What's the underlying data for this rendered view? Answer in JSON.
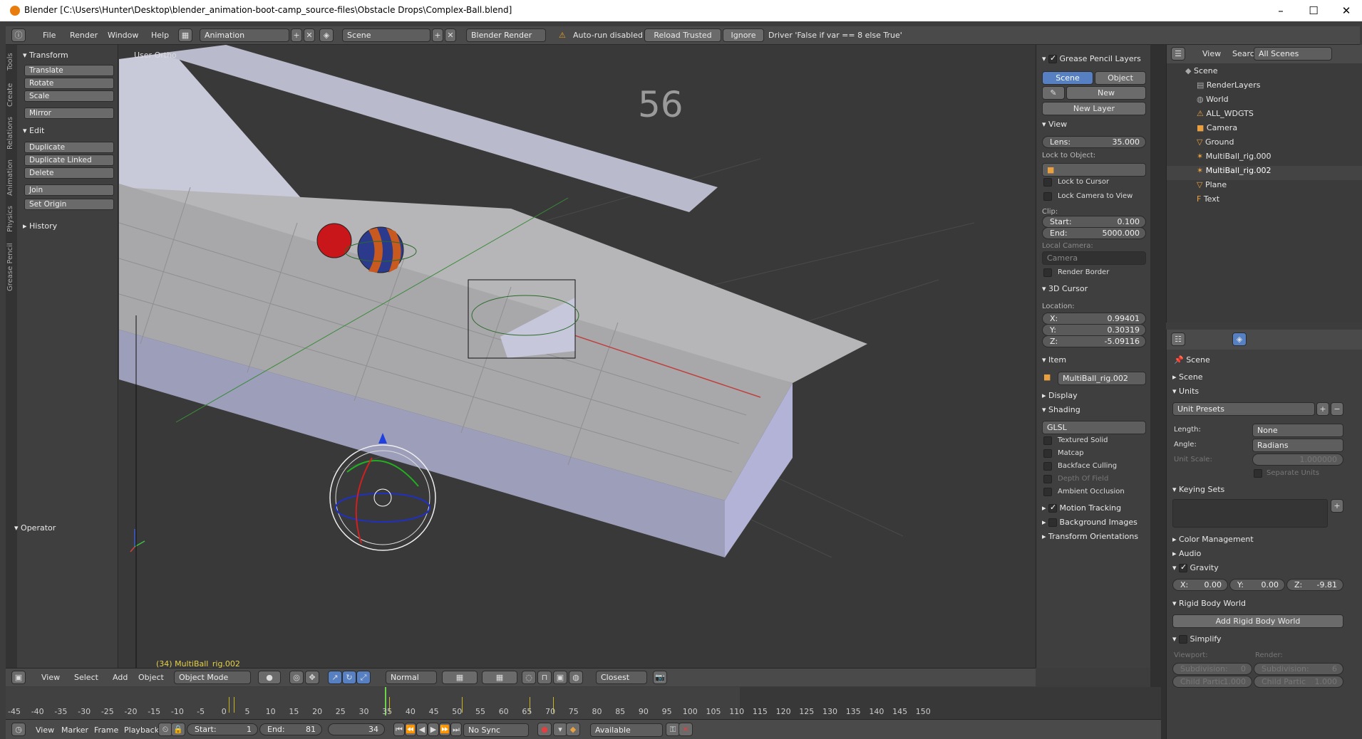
{
  "window": {
    "title": "Blender [C:\\Users\\Hunter\\Desktop\\blender_animation-boot-camp_source-files\\Obstacle Drops\\Complex-Ball.blend]",
    "minimize": "–",
    "maximize": "☐",
    "close": "✕"
  },
  "infobar": {
    "menus": [
      "File",
      "Render",
      "Window",
      "Help"
    ],
    "screen_layout": "Animation",
    "scene": "Scene",
    "engine": "Blender Render",
    "warning": "Auto-run disabled",
    "reload_trusted": "Reload Trusted",
    "ignore": "Ignore",
    "driver_msg": "Driver 'False if var == 8 else True'"
  },
  "toolshelf": {
    "tabs": [
      "Tools",
      "Create",
      "Relations",
      "Animation",
      "Physics",
      "Grease Pencil"
    ],
    "transform_header": "Transform",
    "transform_buttons": [
      "Translate",
      "Rotate",
      "Scale",
      "Mirror"
    ],
    "edit_header": "Edit",
    "edit_buttons": [
      "Duplicate",
      "Duplicate Linked",
      "Delete",
      "Join"
    ],
    "set_origin": "Set Origin",
    "history_header": "History",
    "operator_header": "Operator"
  },
  "viewport": {
    "view_label": "User Ortho",
    "frame_number": "56",
    "active_object": "(34) MultiBall_rig.002"
  },
  "vp_header": {
    "menus": [
      "View",
      "Select",
      "Add",
      "Object"
    ],
    "mode": "Object Mode",
    "orientation": "Normal",
    "snap": "Closest"
  },
  "props3d": {
    "gp_layers_header": "Grease Pencil Layers",
    "scene_tab": "Scene",
    "object_tab": "Object",
    "new_btn": "New",
    "new_layer_btn": "New Layer",
    "view_header": "View",
    "lens_label": "Lens:",
    "lens_value": "35.000",
    "lock_to_object": "Lock to Object:",
    "lock_to_cursor": "Lock to Cursor",
    "lock_camera": "Lock Camera to View",
    "clip_label": "Clip:",
    "clip_start_label": "Start:",
    "clip_start": "0.100",
    "clip_end_label": "End:",
    "clip_end": "5000.000",
    "local_camera": "Local Camera:",
    "camera": "Camera",
    "render_border": "Render Border",
    "cursor_header": "3D Cursor",
    "location_label": "Location:",
    "x_label": "X:",
    "x_value": "0.99401",
    "y_label": "Y:",
    "y_value": "0.30319",
    "z_label": "Z:",
    "z_value": "-5.09116",
    "item_header": "Item",
    "item_name": "MultiBall_rig.002",
    "display_header": "Display",
    "shading_header": "Shading",
    "shading_mode": "GLSL",
    "textured_solid": "Textured Solid",
    "matcap": "Matcap",
    "backface": "Backface Culling",
    "dof": "Depth Of Field",
    "ao": "Ambient Occlusion",
    "motion_tracking": "Motion Tracking",
    "bg_images": "Background Images",
    "transform_orient": "Transform Orientations"
  },
  "outliner": {
    "menus": [
      "View",
      "Search"
    ],
    "filter": "All Scenes",
    "rows": [
      "Scene",
      "RenderLayers",
      "World",
      "ALL_WDGTS",
      "Camera",
      "Ground",
      "MultiBall_rig.000",
      "MultiBall_rig.002",
      "Plane",
      "Text"
    ]
  },
  "props": {
    "breadcrumb": "Scene",
    "scene": "Scene",
    "units": "Units",
    "unit_presets": "Unit Presets",
    "length_label": "Length:",
    "length_value": "None",
    "angle_label": "Angle:",
    "angle_value": "Radians",
    "unit_scale_label": "Unit Scale:",
    "unit_scale_value": "1.000000",
    "separate_units": "Separate Units",
    "keying_sets": "Keying Sets",
    "color_mgmt": "Color Management",
    "audio": "Audio",
    "gravity": "Gravity",
    "gx_label": "X:",
    "gx": "0.00",
    "gy_label": "Y:",
    "gy": "0.00",
    "gz_label": "Z:",
    "gz": "-9.81",
    "rigid_body_world": "Rigid Body World",
    "add_rbw": "Add Rigid Body World",
    "simplify": "Simplify",
    "viewport_label": "Viewport:",
    "render_label": "Render:",
    "subdiv_label": "Subdivision:",
    "subdiv_viewport": "0",
    "subdiv_render": "6",
    "child_label": "Child Partic",
    "child_value": "1.000"
  },
  "timeline": {
    "ticks": [
      "-45",
      "-40",
      "-35",
      "-30",
      "-25",
      "-20",
      "-15",
      "-10",
      "-5",
      "0",
      "5",
      "10",
      "15",
      "20",
      "25",
      "30",
      "35",
      "40",
      "45",
      "50",
      "55",
      "60",
      "65",
      "70",
      "75",
      "80",
      "85",
      "90",
      "95",
      "100",
      "105",
      "110",
      "115",
      "120",
      "125",
      "130",
      "135",
      "140",
      "145",
      "150"
    ],
    "menus": [
      "View",
      "Marker",
      "Frame",
      "Playback"
    ],
    "start_label": "Start:",
    "start": "1",
    "end_label": "End:",
    "end": "81",
    "current": "34",
    "sync": "No Sync",
    "keying": "Available"
  }
}
